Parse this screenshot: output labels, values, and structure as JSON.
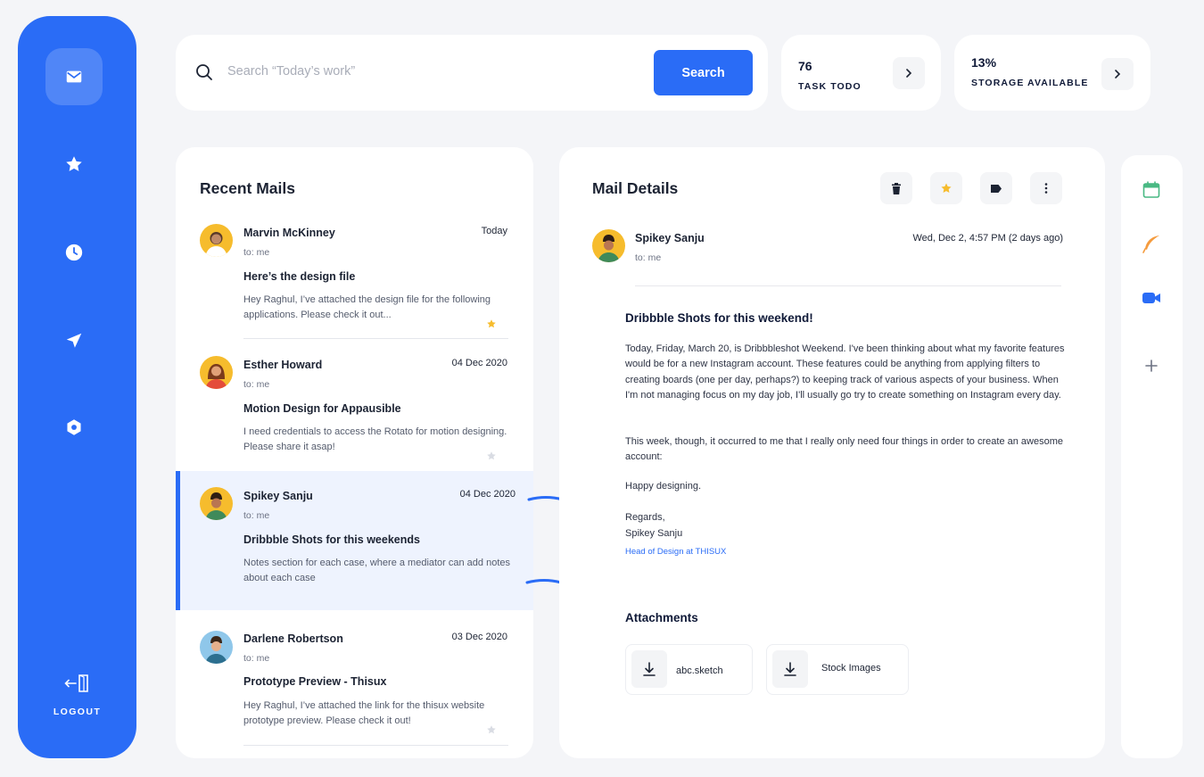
{
  "sidebar": {
    "items": [
      {
        "icon": "mail-icon",
        "active": true
      },
      {
        "icon": "star-icon",
        "active": false
      },
      {
        "icon": "clock-icon",
        "active": false
      },
      {
        "icon": "send-icon",
        "active": false
      },
      {
        "icon": "hexagon-icon",
        "active": false
      }
    ],
    "logout_label": "LOGOUT"
  },
  "search": {
    "placeholder": "Search “Today’s work”",
    "value": "",
    "button_label": "Search"
  },
  "stats": [
    {
      "value": "76",
      "label": "TASK TODO"
    },
    {
      "value": "13%",
      "label": "STORAGE AVAILABLE"
    }
  ],
  "recent_mails": {
    "title": "Recent Mails",
    "items": [
      {
        "sender": "Marvin McKinney",
        "date": "Today",
        "to": "to: me",
        "subject": "Here’s the design file",
        "preview": "Hey Raghul, I’ve attached the design file for the following applications. Please check it out...",
        "starred": true
      },
      {
        "sender": "Esther Howard",
        "date": "04 Dec 2020",
        "to": "to: me",
        "subject": "Motion Design for Appausible",
        "preview": "I need credentials to access the Rotato for motion designing. Please share it asap!",
        "starred": false
      },
      {
        "sender": "Spikey Sanju",
        "date": "04 Dec 2020",
        "to": "to: me",
        "subject": "Dribbble Shots for this weekends",
        "preview": "Notes section for each case, where a mediator can add notes about each case",
        "selected": true
      },
      {
        "sender": "Darlene Robertson",
        "date": "03 Dec 2020",
        "to": "to: me",
        "subject": "Prototype Preview - Thisux",
        "preview": "Hey Raghul, I’ve attached the link for the thisux website prototype preview. Please check it out!",
        "starred": false
      }
    ]
  },
  "mail_details": {
    "title": "Mail Details",
    "toolbar": [
      "trash-icon",
      "star-icon",
      "tag-icon",
      "more-vertical-icon"
    ],
    "sender": "Spikey Sanju",
    "to": "to: me",
    "date": "Wed, Dec 2, 4:57 PM (2 days ago)",
    "subject": "Dribbble Shots for this weekend!",
    "paragraph1": "Today, Friday, March 20, is Dribbbleshot Weekend. I've been thinking about what my favorite features would be for a new Instagram account. These features could be anything from applying filters to creating boards (one per day, perhaps?) to keeping track of various aspects of your business. When I'm not managing focus on my day job, I'll usually go try to create something on Instagram every day.",
    "paragraph2": "This week, though, it occurred to me that I really only need four things in order to create an awesome account:",
    "paragraph3": "Happy designing.",
    "regards": "Regards,",
    "signature": "Spikey Sanju",
    "role": "Head of Design at THISUX",
    "attachments_title": "Attachments",
    "attachments": [
      {
        "name": "abc.sketch",
        "icon": "download-icon"
      },
      {
        "name": "Stock Images",
        "icon": "download-icon"
      }
    ]
  },
  "apps": [
    "calendar-icon",
    "feather-icon",
    "video-camera-icon",
    "plus-icon"
  ],
  "colors": {
    "primary": "#2a6cf6",
    "star": "#f6bc2d",
    "background": "#f4f5f8"
  }
}
